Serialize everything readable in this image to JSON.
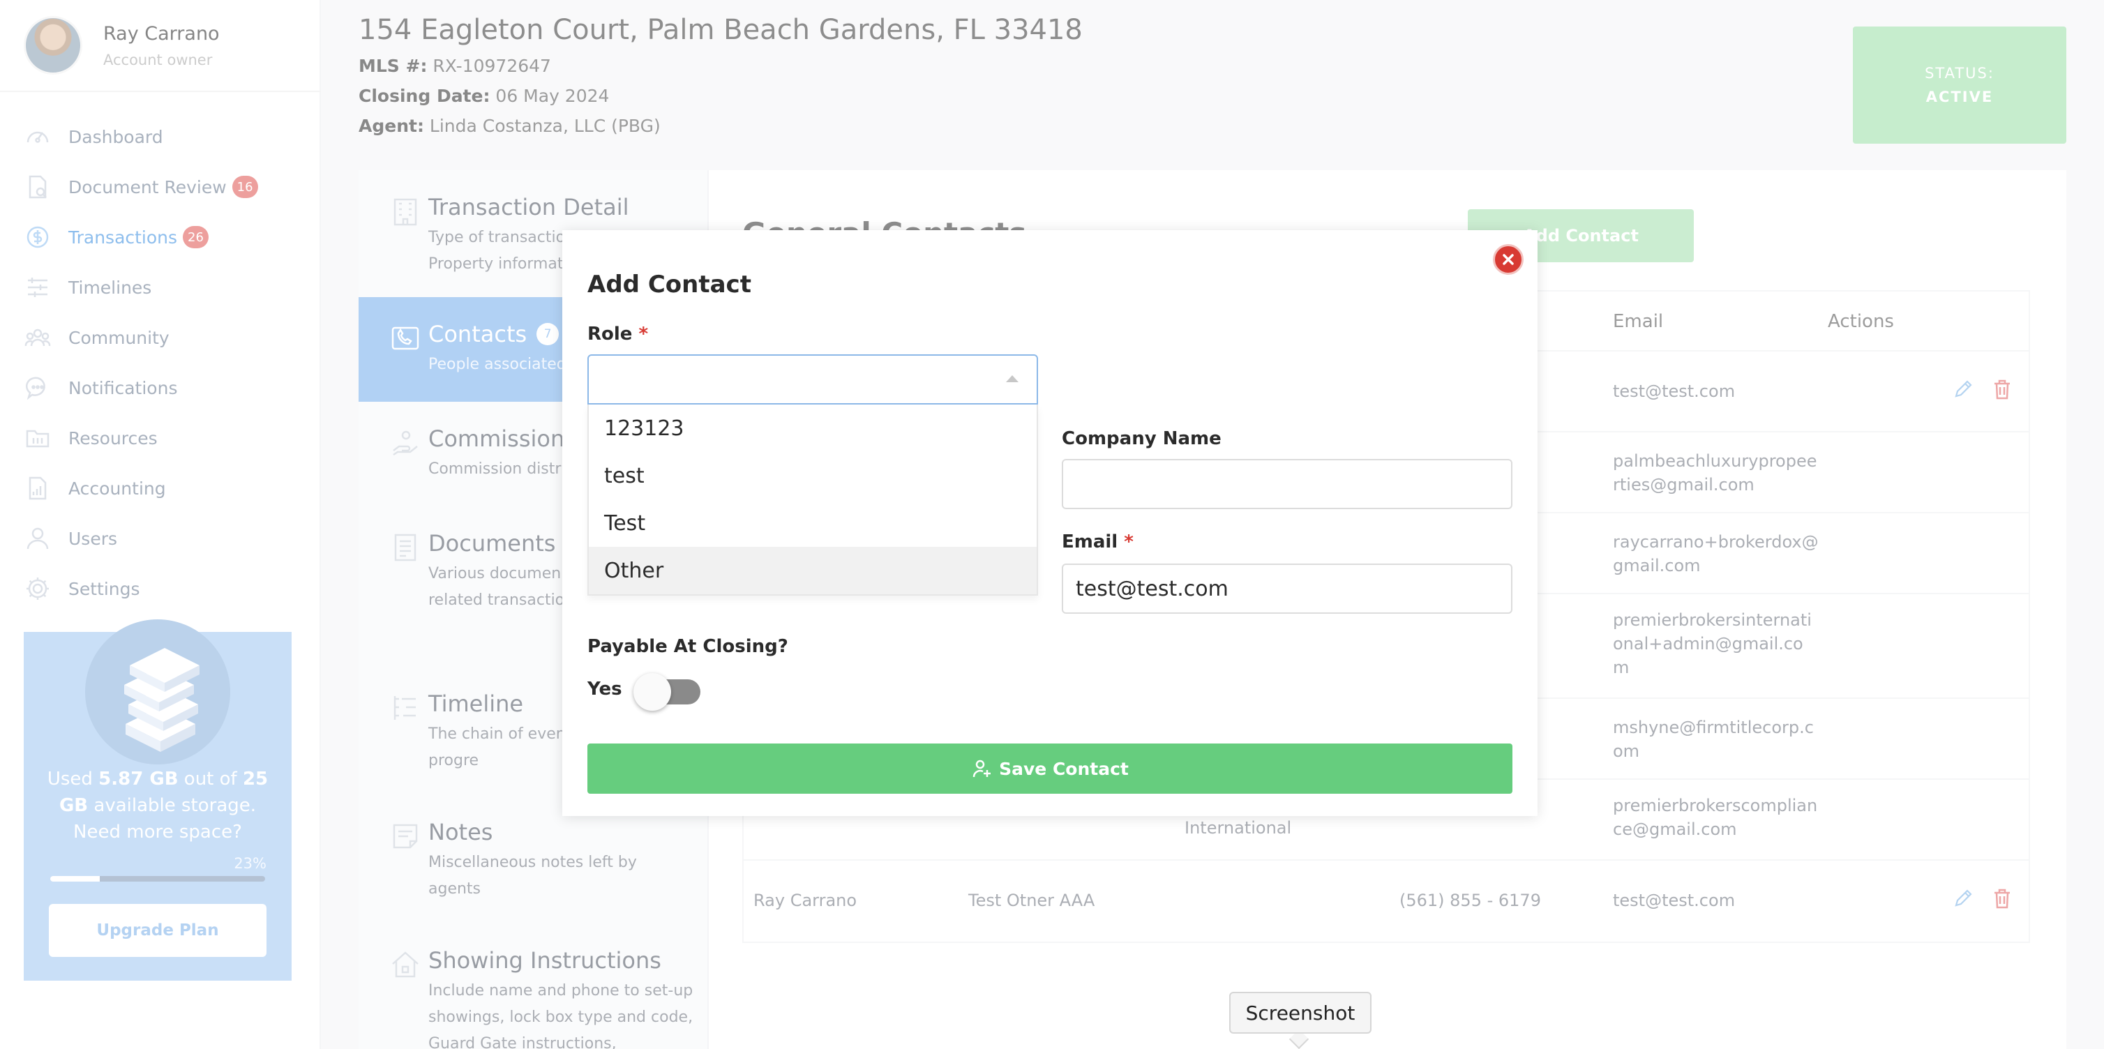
{
  "profile": {
    "name": "Ray Carrano",
    "role": "Account owner"
  },
  "nav": [
    {
      "label": "Dashboard",
      "icon": "dashboard-icon",
      "badge": ""
    },
    {
      "label": "Document Review",
      "icon": "document-review-icon",
      "badge": "16"
    },
    {
      "label": "Transactions",
      "icon": "transactions-icon",
      "badge": "26"
    },
    {
      "label": "Timelines",
      "icon": "timelines-icon",
      "badge": ""
    },
    {
      "label": "Community",
      "icon": "community-icon",
      "badge": ""
    },
    {
      "label": "Notifications",
      "icon": "notifications-icon",
      "badge": ""
    },
    {
      "label": "Resources",
      "icon": "resources-icon",
      "badge": ""
    },
    {
      "label": "Accounting",
      "icon": "accounting-icon",
      "badge": ""
    },
    {
      "label": "Users",
      "icon": "users-icon",
      "badge": ""
    },
    {
      "label": "Settings",
      "icon": "settings-icon",
      "badge": ""
    }
  ],
  "storage": {
    "used_prefix": "Used ",
    "used": "5.87 GB",
    "middle": " out of ",
    "total": "25",
    "line2_bold": "GB",
    "line2": " available storage.",
    "line3": "Need more space?",
    "percent_label": "23%",
    "percent_value": 0.23,
    "upgrade_label": "Upgrade Plan"
  },
  "header": {
    "address": "154 Eagleton Court, Palm Beach Gardens, FL 33418",
    "mls_key": "MLS #:",
    "mls_value": "RX-10972647",
    "closing_key": "Closing Date:",
    "closing_value": "06 May 2024",
    "agent_key": "Agent:",
    "agent_value": "Linda Costanza, LLC (PBG)",
    "status_key": "STATUS:",
    "status_value": "ACTIVE"
  },
  "sections": [
    {
      "title": "Transaction Detail",
      "desc": "Type of transaction, Agent and Property information",
      "count": "",
      "icon": "building-icon"
    },
    {
      "title": "Contacts",
      "desc": "People associated",
      "count": "7",
      "icon": "contacts-icon"
    },
    {
      "title": "Commissions",
      "desc": "Commission distri",
      "count": "",
      "icon": "commission-icon"
    },
    {
      "title": "Documents",
      "desc": "Various documen contracts related transaction",
      "count": "",
      "icon": "documents-icon"
    },
    {
      "title": "Timeline",
      "desc": "The chain of even the deal is progre",
      "count": "",
      "icon": "timeline-icon"
    },
    {
      "title": "Notes",
      "desc": "Miscellaneous notes left by agents",
      "count": "",
      "icon": "notes-icon"
    },
    {
      "title": "Showing Instructions",
      "desc": "Include name and phone to set-up showings, lock box type and code, Guard Gate instructions,",
      "count": "",
      "icon": "house-icon"
    }
  ],
  "contacts": {
    "heading": "General Contacts",
    "add_label": "Add Contact",
    "columns": {
      "email": "Email",
      "actions": "Actions"
    },
    "rows": [
      {
        "email": "test@test.com",
        "actions": true
      },
      {
        "email": "palmbeachluxurypropeerties@gmail.com",
        "actions": false
      },
      {
        "email": "raycarrano+brokerdox@gmail.com",
        "actions": false
      },
      {
        "email": "premierbrokersinternational+admin@gmail.com",
        "actions": false
      },
      {
        "email": "mshyne@firmtitlecorp.com",
        "actions": false
      },
      {
        "company": "International",
        "email": "premierbrokerscompliance@gmail.com",
        "actions": false
      },
      {
        "name": "Ray Carrano",
        "role": "Test Otner AAA",
        "phone": "(561) 855 - 6179",
        "email": "test@test.com",
        "actions": true
      }
    ]
  },
  "modal": {
    "title": "Add Contact",
    "role_label": "Role",
    "role_value": "",
    "role_options": [
      "123123",
      "test",
      "Test",
      "Other"
    ],
    "company_label": "Company Name",
    "company_value": "",
    "email_label": "Email",
    "email_value": "test@test.com",
    "payable_label": "Payable At Closing?",
    "payable_option": "Yes",
    "payable_on": false,
    "save_label": "Save Contact"
  },
  "tooltip": "Screenshot",
  "colors": {
    "accent_blue": "#3d8fe0",
    "success_green": "#66cd7e",
    "danger_red": "#d83a33",
    "badge_red": "#e05a57"
  }
}
